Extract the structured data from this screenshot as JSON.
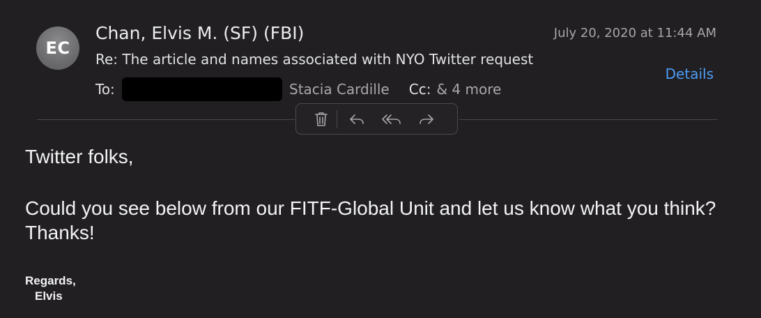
{
  "email": {
    "avatar_initials": "EC",
    "sender": "Chan, Elvis M. (SF) (FBI)",
    "date": "July 20, 2020 at 11:44 AM",
    "subject": "Re: The article and names associated with NYO Twitter request",
    "details_link": "Details",
    "to_label": "To:",
    "recipient": "Stacia Cardille",
    "cc_label": "Cc:",
    "cc_more": "& 4 more"
  },
  "toolbar": {
    "icons": [
      "trash-icon",
      "reply-icon",
      "reply-all-icon",
      "forward-icon"
    ]
  },
  "body": {
    "greeting": "Twitter folks,",
    "message": "Could you see below from our FITF-Global Unit and let us know what you think?  Thanks!",
    "regards": "Regards,",
    "signature": "Elvis"
  },
  "colors": {
    "background": "#211f22",
    "accent_link": "#4c9df5",
    "avatar": "#6c6c6e"
  }
}
